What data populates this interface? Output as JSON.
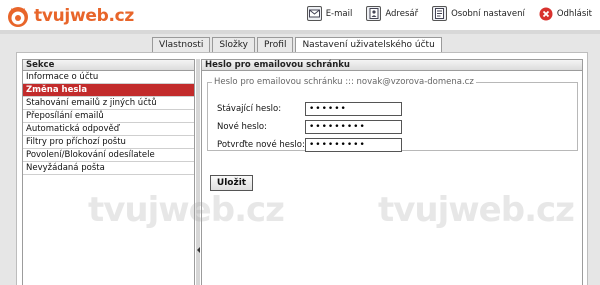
{
  "brand": {
    "logo_text": "tvujweb.cz",
    "watermark": "tvujweb.cz",
    "accent_color": "#e8652a"
  },
  "toplinks": [
    {
      "label": "E-mail",
      "icon": "envelope-icon"
    },
    {
      "label": "Adresář",
      "icon": "address-book-icon"
    },
    {
      "label": "Osobní nastavení",
      "icon": "settings-page-icon"
    },
    {
      "label": "Odhlásit",
      "icon": "logout-icon"
    }
  ],
  "tabs": [
    {
      "label": "Vlastnosti",
      "active": false
    },
    {
      "label": "Složky",
      "active": false
    },
    {
      "label": "Profil",
      "active": false
    },
    {
      "label": "Nastavení uživatelského účtu",
      "active": true
    }
  ],
  "sidebar": {
    "title": "Sekce",
    "items": [
      {
        "label": "Informace o účtu",
        "active": false
      },
      {
        "label": "Změna hesla",
        "active": true
      },
      {
        "label": "Stahování emailů z jiných účtů",
        "active": false
      },
      {
        "label": "Přeposílání emailů",
        "active": false
      },
      {
        "label": "Automatická odpověď",
        "active": false
      },
      {
        "label": "Filtry pro příchozí poštu",
        "active": false
      },
      {
        "label": "Povolení/Blokování odesílatele",
        "active": false
      },
      {
        "label": "Nevyžádaná pošta",
        "active": false
      }
    ]
  },
  "content": {
    "title": "Heslo pro emailovou schránku",
    "legend": "Heslo pro emailovou schránku ::: novak@vzorova-domena.cz",
    "fields": [
      {
        "label": "Stávající heslo:",
        "value": "••••••"
      },
      {
        "label": "Nové heslo:",
        "value": "•••••••••"
      },
      {
        "label": "Potvrďte nové heslo:",
        "value": "•••••••••"
      }
    ],
    "save_label": "Uložit"
  }
}
